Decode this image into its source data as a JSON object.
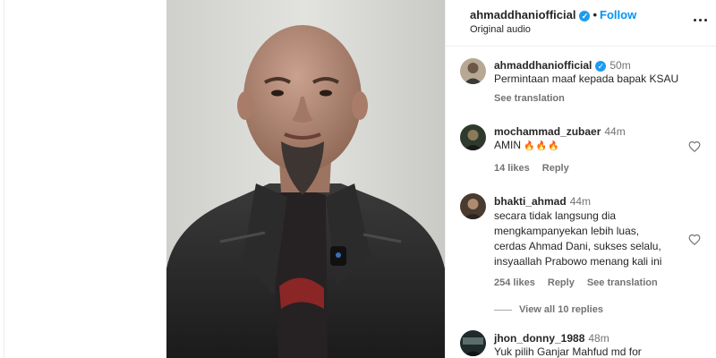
{
  "post": {
    "username": "ahmaddhaniofficial",
    "verified_mark": "✓",
    "separator": "•",
    "follow_label": "Follow",
    "audio_label": "Original audio",
    "more_icon": "more-horizontal-icon"
  },
  "comments": [
    {
      "username": "ahmaddhaniofficial",
      "verified_mark": "✓",
      "time": "50m",
      "lines": [
        "Permintaan maaf kepada bapak KSAU"
      ],
      "see_translation": "See translation"
    },
    {
      "username": "mochammad_zubaer",
      "time": "44m",
      "text": "AMIN",
      "emoji": "🔥🔥🔥",
      "likes": "14 likes",
      "reply": "Reply"
    },
    {
      "username": "bhakti_ahmad",
      "time": "44m",
      "lines": [
        "secara tidak langsung dia",
        "mengkampanyekan lebih luas,",
        "cerdas Ahmad Dani, sukses selalu,",
        "insyaallah Prabowo menang kali ini"
      ],
      "likes": "254 likes",
      "reply": "Reply",
      "see_translation": "See translation",
      "view_replies": "View all 10 replies"
    },
    {
      "username": "jhon_donny_1988",
      "time": "48m",
      "lines": [
        "Yuk pilih Ganjar Mahfud md for"
      ]
    }
  ],
  "colors": {
    "link": "#0095f6",
    "verified": "#1d9bf0",
    "muted": "#737373",
    "text": "#262626"
  }
}
